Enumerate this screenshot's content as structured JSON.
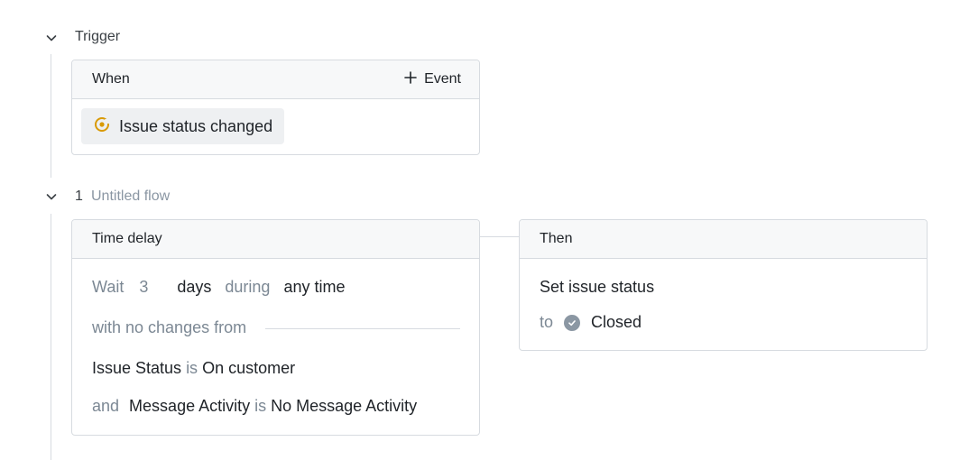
{
  "trigger": {
    "label": "Trigger",
    "when_card": {
      "header": "When",
      "add_event_label": "Event",
      "event_chip_label": "Issue status changed"
    }
  },
  "flow": {
    "number": "1",
    "name": "Untitled flow",
    "time_delay": {
      "header": "Time delay",
      "wait_label": "Wait",
      "wait_amount": "3",
      "wait_unit": "days",
      "during_label": "during",
      "during_value": "any time",
      "with_no_changes_label": "with no changes from",
      "condition1": {
        "field": "Issue Status",
        "op": "is",
        "value": "On customer"
      },
      "condition2": {
        "joiner": "and",
        "field": "Message Activity",
        "op": "is",
        "value": "No Message Activity"
      }
    },
    "then": {
      "header": "Then",
      "action": "Set issue status",
      "to_label": "to",
      "status_value": "Closed"
    }
  },
  "colors": {
    "event_icon": "#d99a06",
    "muted_text": "#7c8894",
    "border": "#d7dbe0"
  },
  "icons": [
    "chevron-down-icon",
    "plus-icon",
    "issue-status-icon",
    "check-circle-icon"
  ]
}
